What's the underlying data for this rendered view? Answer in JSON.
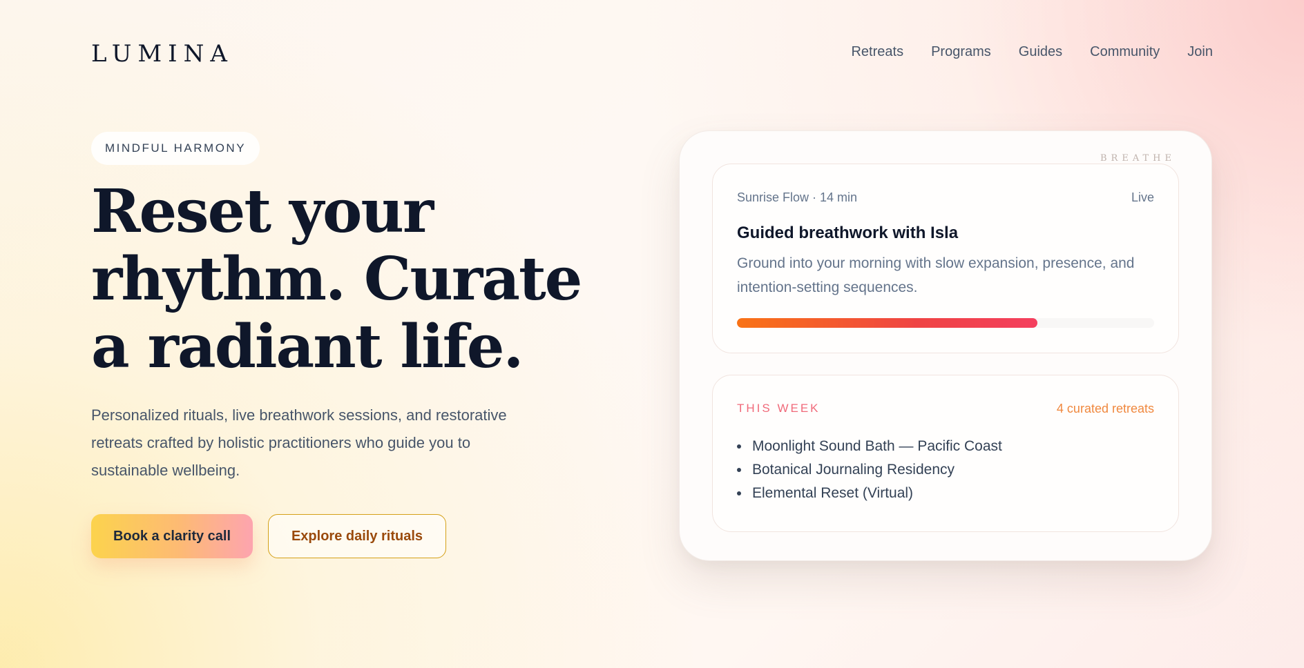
{
  "brand": {
    "logo": "LUMINA"
  },
  "nav": {
    "items": [
      {
        "label": "Retreats"
      },
      {
        "label": "Programs"
      },
      {
        "label": "Guides"
      },
      {
        "label": "Community"
      },
      {
        "label": "Join"
      }
    ]
  },
  "hero": {
    "eyebrow": "MINDFUL HARMONY",
    "headline": "Reset your rhythm. Curate a radiant life.",
    "subtext": "Personalized rituals, live breathwork sessions, and restorative retreats crafted by holistic practitioners who guide you to sustainable wellbeing.",
    "primary_cta": "Book a clarity call",
    "secondary_cta": "Explore daily rituals"
  },
  "panel": {
    "watermark": "BREATHE",
    "session": {
      "meta": "Sunrise Flow · 14 min",
      "status": "Live",
      "title": "Guided breathwork with Isla",
      "description": "Ground into your morning with slow expansion, presence, and intention-setting sequences.",
      "progress": 0.72
    },
    "this_week": {
      "label": "THIS WEEK",
      "count": "4 curated retreats",
      "retreats": [
        "Moonlight Sound Bath — Pacific Coast",
        "Botanical Journaling Residency",
        "Elemental Reset (Virtual)"
      ]
    }
  },
  "colors": {
    "ink": "#0f172a",
    "muted": "#64748b",
    "accent_pink": "#f06a7a",
    "accent_orange": "#f0883e",
    "progress_start": "#f97316",
    "progress_end": "#f43f5e",
    "secondary_cta_text": "#9a4a0c"
  }
}
